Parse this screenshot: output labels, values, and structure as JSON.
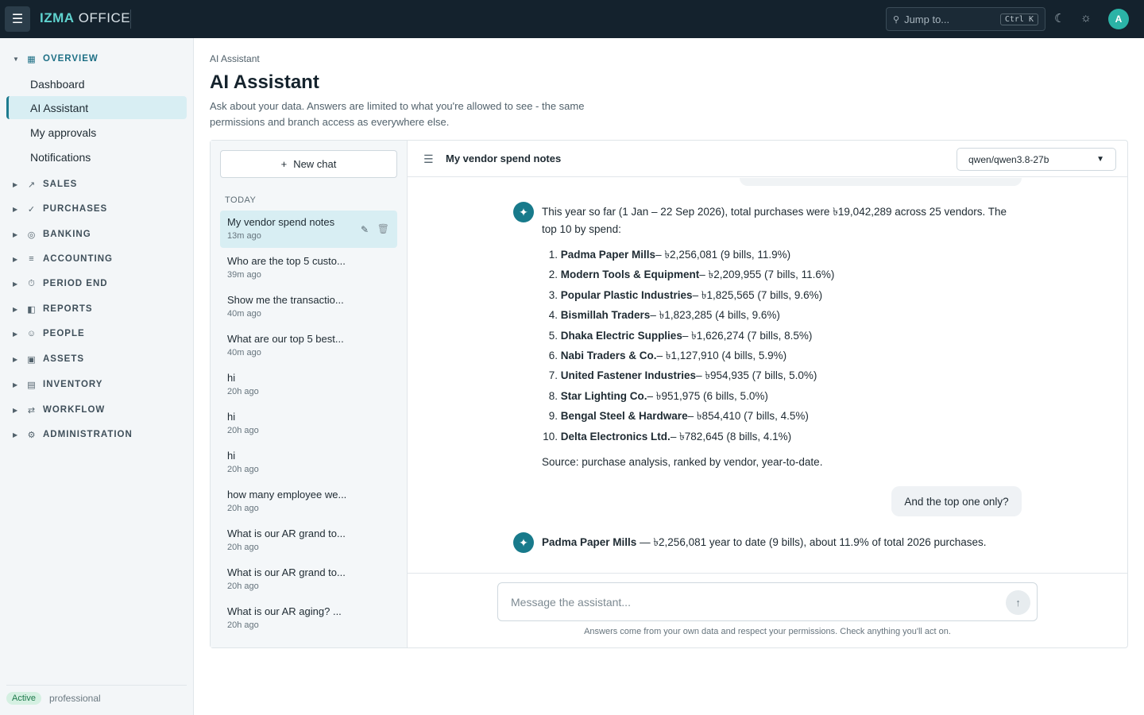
{
  "app": {
    "brand_primary": "IZMA",
    "brand_secondary": "OFFICE",
    "avatar_initial": "A"
  },
  "topbar": {
    "jump_placeholder": "Jump to...",
    "jump_shortcut": "Ctrl K"
  },
  "sidebar": {
    "overview_label": "OVERVIEW",
    "overview_items": [
      "Dashboard",
      "AI Assistant",
      "My approvals",
      "Notifications"
    ],
    "sections": [
      "SALES",
      "PURCHASES",
      "BANKING",
      "ACCOUNTING",
      "PERIOD END",
      "REPORTS",
      "PEOPLE",
      "ASSETS",
      "INVENTORY",
      "WORKFLOW",
      "ADMINISTRATION"
    ],
    "status_badge": "Active",
    "plan": "professional"
  },
  "page": {
    "breadcrumb": "AI Assistant",
    "title": "AI Assistant",
    "description": "Ask about your data. Answers are limited to what you're allowed to see - the same permissions and branch access as everywhere else."
  },
  "chats": {
    "new_chat_label": "New chat",
    "group_label": "TODAY",
    "items": [
      {
        "title": "My vendor spend notes",
        "time": "13m ago"
      },
      {
        "title": "Who are the top 5 custo...",
        "time": "39m ago"
      },
      {
        "title": "Show me the transactio...",
        "time": "40m ago"
      },
      {
        "title": "What are our top 5 best...",
        "time": "40m ago"
      },
      {
        "title": "hi",
        "time": "20h ago"
      },
      {
        "title": "hi",
        "time": "20h ago"
      },
      {
        "title": "hi",
        "time": "20h ago"
      },
      {
        "title": "how many employee we...",
        "time": "20h ago"
      },
      {
        "title": "What is our AR grand to...",
        "time": "20h ago"
      },
      {
        "title": "What is our AR grand to...",
        "time": "20h ago"
      },
      {
        "title": "What is our AR aging? ...",
        "time": "20h ago"
      }
    ]
  },
  "conversation": {
    "title": "My vendor spend notes",
    "model": "qwen/qwen3.8-27b",
    "answer_intro_line1": "This year so far (1 Jan – 22 Sep 2026), total purchases were ৳19,042,289 across 25 vendors. The",
    "answer_intro_line2": "top 10 by spend:",
    "vendors": [
      {
        "num": "1.",
        "name": "Padma Paper Mills",
        "detail": " – ৳2,256,081 (9 bills, 11.9%)"
      },
      {
        "num": "2.",
        "name": "Modern Tools & Equipment",
        "detail": " – ৳2,209,955 (7 bills, 11.6%)"
      },
      {
        "num": "3.",
        "name": "Popular Plastic Industries",
        "detail": " – ৳1,825,565 (7 bills, 9.6%)"
      },
      {
        "num": "4.",
        "name": "Bismillah Traders",
        "detail": " – ৳1,823,285 (4 bills, 9.6%)"
      },
      {
        "num": "5.",
        "name": "Dhaka Electric Supplies",
        "detail": " – ৳1,626,274 (7 bills, 8.5%)"
      },
      {
        "num": "6.",
        "name": "Nabi Traders & Co.",
        "detail": " – ৳1,127,910 (4 bills, 5.9%)"
      },
      {
        "num": "7.",
        "name": "United Fastener Industries",
        "detail": " – ৳954,935 (7 bills, 5.0%)"
      },
      {
        "num": "8.",
        "name": "Star Lighting Co.",
        "detail": " – ৳951,975 (6 bills, 5.0%)"
      },
      {
        "num": "9.",
        "name": "Bengal Steel & Hardware",
        "detail": " – ৳854,410 (7 bills, 4.5%)"
      },
      {
        "num": "10.",
        "name": "Delta Electronics Ltd.",
        "detail": " – ৳782,645 (8 bills, 4.1%)"
      }
    ],
    "source_note": "Source: purchase analysis, ranked by vendor, year-to-date.",
    "user_followup": "And the top one only?",
    "final_answer_bold": "Padma Paper Mills",
    "final_answer_rest": " — ৳2,256,081 year to date (9 bills), about 11.9% of total 2026 purchases."
  },
  "composer": {
    "placeholder": "Message the assistant...",
    "disclaimer": "Answers come from your own data and respect your permissions. Check anything you'll act on."
  }
}
